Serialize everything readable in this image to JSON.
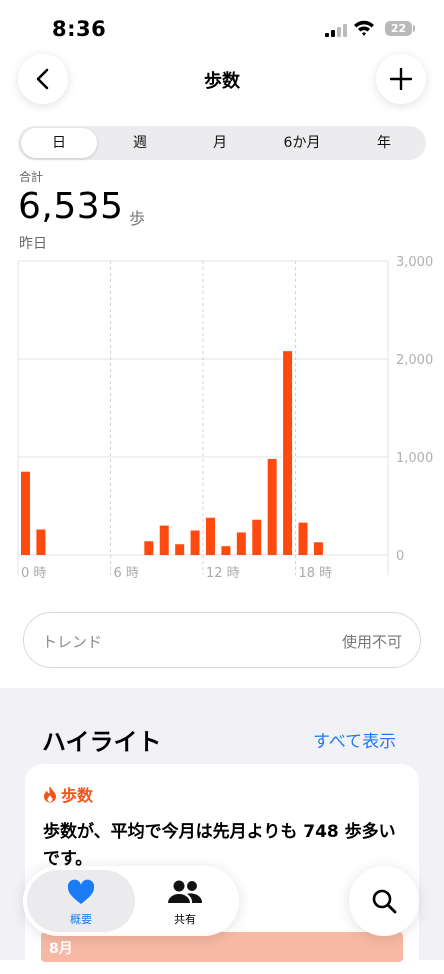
{
  "status": {
    "time": "8:36",
    "battery": "22"
  },
  "nav": {
    "title": "歩数"
  },
  "segments": [
    {
      "label": "日",
      "selected": true
    },
    {
      "label": "週",
      "selected": false
    },
    {
      "label": "月",
      "selected": false
    },
    {
      "label": "6か月",
      "selected": false
    },
    {
      "label": "年",
      "selected": false
    }
  ],
  "summary": {
    "label": "合計",
    "value": "6,535",
    "unit": "歩",
    "date": "昨日"
  },
  "chart_data": {
    "type": "bar",
    "x_ticks": [
      "0 時",
      "6 時",
      "12 時",
      "18 時"
    ],
    "y_ticks": [
      "3,000",
      "2,000",
      "1,000",
      "0"
    ],
    "ylim": [
      0,
      3000
    ],
    "color": "#ff4a0f",
    "hours": [
      0,
      1,
      8,
      9,
      10,
      11,
      12,
      13,
      14,
      15,
      16,
      17,
      18,
      19
    ],
    "values": [
      850,
      260,
      140,
      300,
      110,
      250,
      380,
      90,
      230,
      360,
      980,
      2080,
      330,
      130
    ]
  },
  "trend": {
    "label": "トレンド",
    "value": "使用不可"
  },
  "highlights": {
    "title": "ハイライト",
    "show_all": "すべて表示",
    "card": {
      "tag": "歩数",
      "text": "歩数が、平均で今月は先月よりも 748 歩多いです。",
      "bar_label": "8月"
    }
  },
  "tabbar": {
    "summary": "概要",
    "sharing": "共有"
  }
}
